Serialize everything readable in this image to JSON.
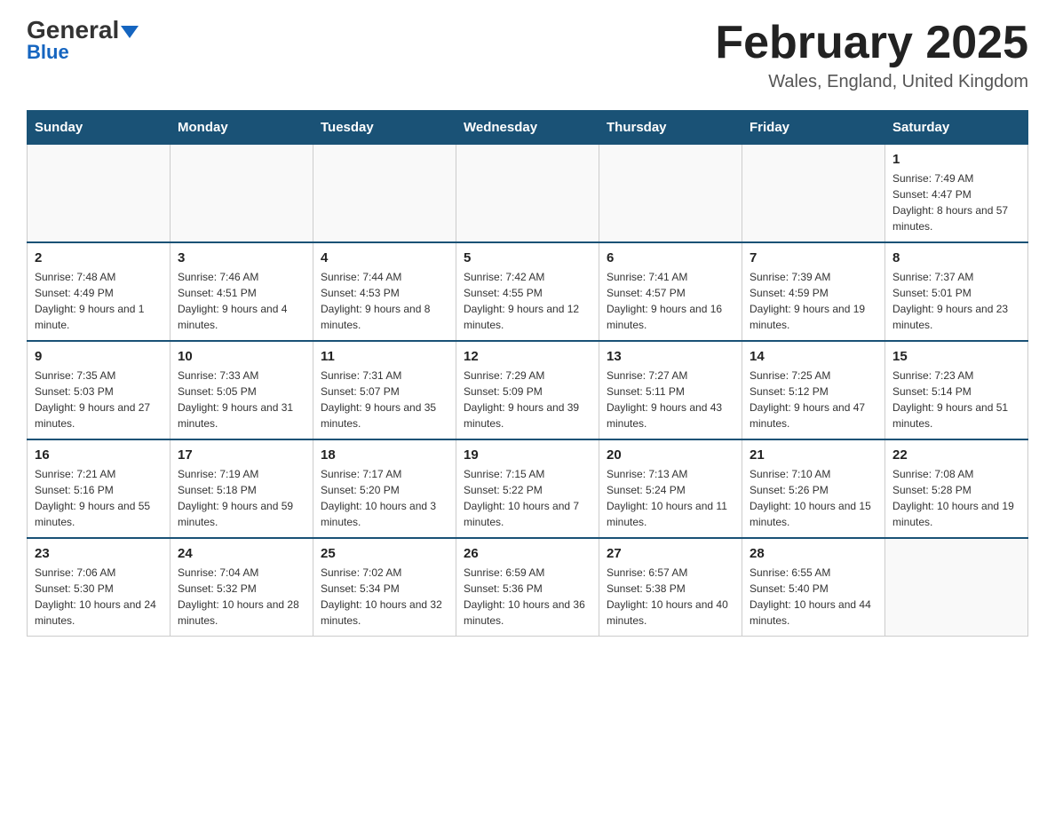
{
  "header": {
    "logo_text_general": "General",
    "logo_text_blue": "Blue",
    "title": "February 2025",
    "subtitle": "Wales, England, United Kingdom"
  },
  "calendar": {
    "days_of_week": [
      "Sunday",
      "Monday",
      "Tuesday",
      "Wednesday",
      "Thursday",
      "Friday",
      "Saturday"
    ],
    "weeks": [
      [
        {
          "day": "",
          "info": ""
        },
        {
          "day": "",
          "info": ""
        },
        {
          "day": "",
          "info": ""
        },
        {
          "day": "",
          "info": ""
        },
        {
          "day": "",
          "info": ""
        },
        {
          "day": "",
          "info": ""
        },
        {
          "day": "1",
          "info": "Sunrise: 7:49 AM\nSunset: 4:47 PM\nDaylight: 8 hours and 57 minutes."
        }
      ],
      [
        {
          "day": "2",
          "info": "Sunrise: 7:48 AM\nSunset: 4:49 PM\nDaylight: 9 hours and 1 minute."
        },
        {
          "day": "3",
          "info": "Sunrise: 7:46 AM\nSunset: 4:51 PM\nDaylight: 9 hours and 4 minutes."
        },
        {
          "day": "4",
          "info": "Sunrise: 7:44 AM\nSunset: 4:53 PM\nDaylight: 9 hours and 8 minutes."
        },
        {
          "day": "5",
          "info": "Sunrise: 7:42 AM\nSunset: 4:55 PM\nDaylight: 9 hours and 12 minutes."
        },
        {
          "day": "6",
          "info": "Sunrise: 7:41 AM\nSunset: 4:57 PM\nDaylight: 9 hours and 16 minutes."
        },
        {
          "day": "7",
          "info": "Sunrise: 7:39 AM\nSunset: 4:59 PM\nDaylight: 9 hours and 19 minutes."
        },
        {
          "day": "8",
          "info": "Sunrise: 7:37 AM\nSunset: 5:01 PM\nDaylight: 9 hours and 23 minutes."
        }
      ],
      [
        {
          "day": "9",
          "info": "Sunrise: 7:35 AM\nSunset: 5:03 PM\nDaylight: 9 hours and 27 minutes."
        },
        {
          "day": "10",
          "info": "Sunrise: 7:33 AM\nSunset: 5:05 PM\nDaylight: 9 hours and 31 minutes."
        },
        {
          "day": "11",
          "info": "Sunrise: 7:31 AM\nSunset: 5:07 PM\nDaylight: 9 hours and 35 minutes."
        },
        {
          "day": "12",
          "info": "Sunrise: 7:29 AM\nSunset: 5:09 PM\nDaylight: 9 hours and 39 minutes."
        },
        {
          "day": "13",
          "info": "Sunrise: 7:27 AM\nSunset: 5:11 PM\nDaylight: 9 hours and 43 minutes."
        },
        {
          "day": "14",
          "info": "Sunrise: 7:25 AM\nSunset: 5:12 PM\nDaylight: 9 hours and 47 minutes."
        },
        {
          "day": "15",
          "info": "Sunrise: 7:23 AM\nSunset: 5:14 PM\nDaylight: 9 hours and 51 minutes."
        }
      ],
      [
        {
          "day": "16",
          "info": "Sunrise: 7:21 AM\nSunset: 5:16 PM\nDaylight: 9 hours and 55 minutes."
        },
        {
          "day": "17",
          "info": "Sunrise: 7:19 AM\nSunset: 5:18 PM\nDaylight: 9 hours and 59 minutes."
        },
        {
          "day": "18",
          "info": "Sunrise: 7:17 AM\nSunset: 5:20 PM\nDaylight: 10 hours and 3 minutes."
        },
        {
          "day": "19",
          "info": "Sunrise: 7:15 AM\nSunset: 5:22 PM\nDaylight: 10 hours and 7 minutes."
        },
        {
          "day": "20",
          "info": "Sunrise: 7:13 AM\nSunset: 5:24 PM\nDaylight: 10 hours and 11 minutes."
        },
        {
          "day": "21",
          "info": "Sunrise: 7:10 AM\nSunset: 5:26 PM\nDaylight: 10 hours and 15 minutes."
        },
        {
          "day": "22",
          "info": "Sunrise: 7:08 AM\nSunset: 5:28 PM\nDaylight: 10 hours and 19 minutes."
        }
      ],
      [
        {
          "day": "23",
          "info": "Sunrise: 7:06 AM\nSunset: 5:30 PM\nDaylight: 10 hours and 24 minutes."
        },
        {
          "day": "24",
          "info": "Sunrise: 7:04 AM\nSunset: 5:32 PM\nDaylight: 10 hours and 28 minutes."
        },
        {
          "day": "25",
          "info": "Sunrise: 7:02 AM\nSunset: 5:34 PM\nDaylight: 10 hours and 32 minutes."
        },
        {
          "day": "26",
          "info": "Sunrise: 6:59 AM\nSunset: 5:36 PM\nDaylight: 10 hours and 36 minutes."
        },
        {
          "day": "27",
          "info": "Sunrise: 6:57 AM\nSunset: 5:38 PM\nDaylight: 10 hours and 40 minutes."
        },
        {
          "day": "28",
          "info": "Sunrise: 6:55 AM\nSunset: 5:40 PM\nDaylight: 10 hours and 44 minutes."
        },
        {
          "day": "",
          "info": ""
        }
      ]
    ]
  }
}
